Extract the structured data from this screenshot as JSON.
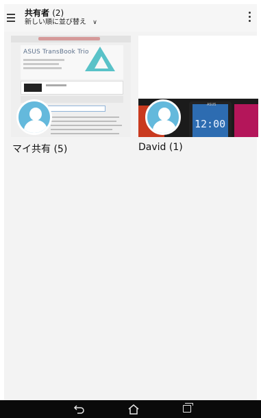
{
  "appbar": {
    "title": "共有者",
    "title_count": "(2)",
    "subtitle": "新しい順に並び替え",
    "subtitle_chevron": "∨"
  },
  "cards": [
    {
      "label": "マイ共有 (5)",
      "thumbnail": "web-page-asus-transbook-trio",
      "avatar_icon": "person-avatar-icon"
    },
    {
      "label": "David (1)",
      "thumbnail": "asus-phones-photo",
      "avatar_icon": "person-avatar-icon"
    }
  ],
  "thumbnail_text": {
    "brand": "ASUS TransBook Trio",
    "clock": "12:00",
    "asus_logo": "ASUS"
  },
  "navbar": {
    "back_glyph": "⮌",
    "home_glyph": "⌂"
  },
  "colors": {
    "background": "#f3f3f3",
    "avatar": "#64b9dc",
    "navbar": "#0a0a0a"
  }
}
